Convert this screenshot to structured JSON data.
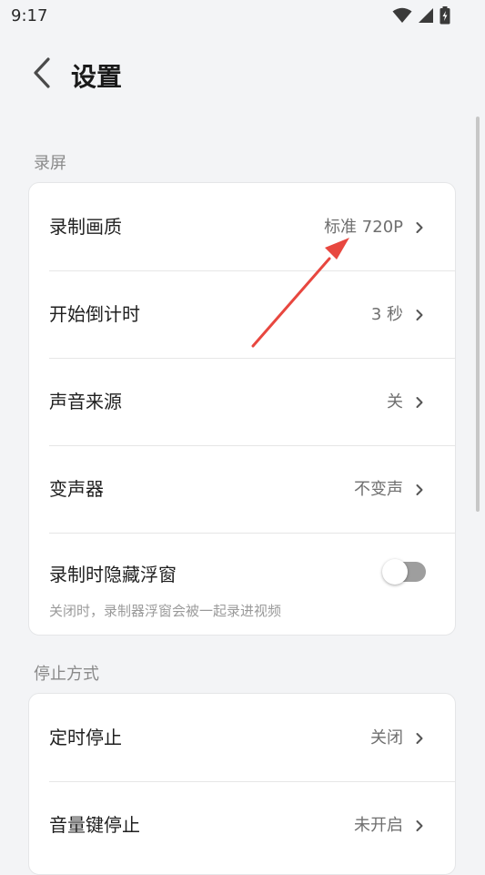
{
  "status_bar": {
    "time": "9:17",
    "icons": [
      "wifi-icon",
      "signal-icon",
      "battery-charging-icon"
    ]
  },
  "header": {
    "title": "设置",
    "back_icon": "back-chevron-icon"
  },
  "sections": {
    "recording": {
      "label": "录屏",
      "rows": {
        "quality": {
          "label": "录制画质",
          "value": "标准 720P"
        },
        "countdown": {
          "label": "开始倒计时",
          "value": "3 秒"
        },
        "audio_source": {
          "label": "声音来源",
          "value": "关"
        },
        "voice_changer": {
          "label": "变声器",
          "value": "不变声"
        },
        "hide_float": {
          "label": "录制时隐藏浮窗",
          "description": "关闭时，录制器浮窗会被一起录进视频",
          "enabled": false
        }
      }
    },
    "stop_method": {
      "label": "停止方式",
      "rows": {
        "timed_stop": {
          "label": "定时停止",
          "value": "关闭"
        },
        "volume_key_stop": {
          "label": "音量键停止",
          "value": "未开启"
        }
      }
    }
  },
  "colors": {
    "background": "#f3f4f6",
    "card": "#ffffff",
    "annotation_arrow": "#e8473f",
    "toggle_off": "#9e9e9e"
  }
}
